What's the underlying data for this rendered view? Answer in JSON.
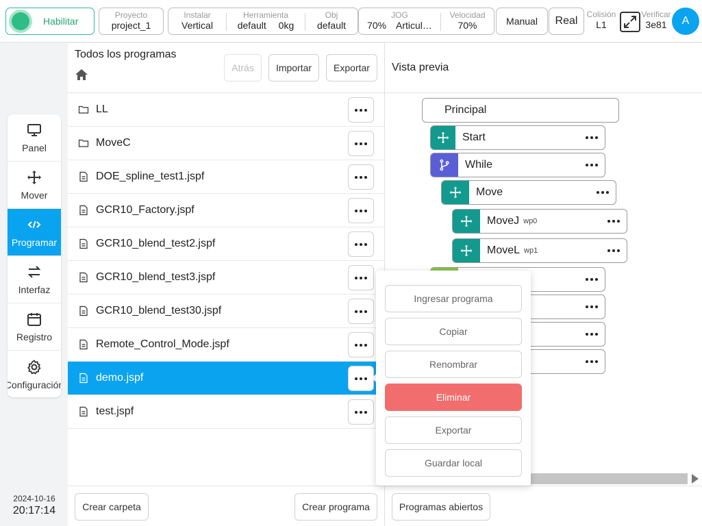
{
  "topbar": {
    "enable_label": "Habilitar",
    "project": {
      "title": "Proyecto",
      "value": "project_1"
    },
    "install": {
      "title": "Instalar",
      "value": "Vertical"
    },
    "tool": {
      "title": "Herramienta",
      "value": "default",
      "weight": "0kg"
    },
    "obj": {
      "title": "Obj",
      "value": "default"
    },
    "jog": {
      "title": "JOG",
      "value": "70%",
      "mode": "Articul…"
    },
    "speed": {
      "title": "Velocidad",
      "value": "70%"
    },
    "manual_label": "Manual",
    "real_label": "Real",
    "collision": {
      "title": "Colisión",
      "value": "L1"
    },
    "verify": {
      "title": "Verificar",
      "value": "3e81"
    },
    "avatar_letter": "A"
  },
  "sidebar": {
    "items": [
      {
        "label": "Panel",
        "icon": "monitor-icon"
      },
      {
        "label": "Mover",
        "icon": "move-icon"
      },
      {
        "label": "Programar",
        "icon": "code-icon",
        "active": true
      },
      {
        "label": "Interfaz",
        "icon": "swap-icon"
      },
      {
        "label": "Registro",
        "icon": "calendar-icon"
      },
      {
        "label": "Configuración",
        "icon": "gear-icon"
      }
    ],
    "date": "2024-10-16",
    "time": "20:17:14"
  },
  "list": {
    "title": "Todos los programas",
    "back_label": "Atrás",
    "import_label": "Importar",
    "export_label": "Exportar",
    "files": [
      {
        "name": "LL",
        "type": "folder"
      },
      {
        "name": "MoveC",
        "type": "folder"
      },
      {
        "name": "DOE_spline_test1.jspf",
        "type": "file"
      },
      {
        "name": "GCR10_Factory.jspf",
        "type": "file"
      },
      {
        "name": "GCR10_blend_test2.jspf",
        "type": "file"
      },
      {
        "name": "GCR10_blend_test3.jspf",
        "type": "file"
      },
      {
        "name": "GCR10_blend_test30.jspf",
        "type": "file"
      },
      {
        "name": "Remote_Control_Mode.jspf",
        "type": "file"
      },
      {
        "name": "demo.jspf",
        "type": "file",
        "selected": true
      },
      {
        "name": "test.jspf",
        "type": "file"
      }
    ],
    "create_folder_label": "Crear carpeta",
    "create_program_label": "Crear programa"
  },
  "preview": {
    "title": "Vista previa",
    "root": "Principal",
    "nodes": [
      {
        "label": "Start",
        "sub": "",
        "icon": "move-icon"
      },
      {
        "label": "While",
        "sub": "",
        "icon": "branch-icon"
      },
      {
        "label": "Move",
        "sub": "",
        "icon": "move-icon"
      },
      {
        "label": "MoveJ",
        "sub": "wp0",
        "icon": "move-icon"
      },
      {
        "label": "MoveL",
        "sub": "wp1",
        "icon": "move-icon"
      }
    ],
    "open_programs_label": "Programas abiertos"
  },
  "context_menu": {
    "items": [
      {
        "label": "Ingresar programa"
      },
      {
        "label": "Copiar"
      },
      {
        "label": "Renombrar"
      },
      {
        "label": "Eliminar",
        "danger": true
      },
      {
        "label": "Exportar"
      },
      {
        "label": "Guardar local"
      }
    ]
  },
  "colors": {
    "accent": "#0aa3f0",
    "enable_green": "#2fbd85",
    "move_teal": "#129a8f",
    "while_purple": "#5b5fd6",
    "danger": "#f26d6d",
    "hidden_node_green": "#8bc34a"
  }
}
